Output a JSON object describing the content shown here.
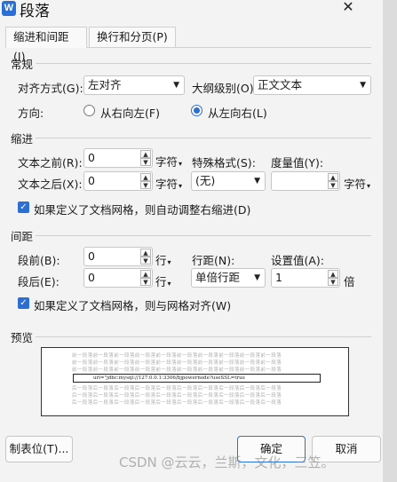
{
  "window": {
    "title": "段落",
    "app_icon_letter": "W",
    "close_glyph": "✕"
  },
  "tabs": [
    {
      "label": "缩进和间距(I)",
      "active": true
    },
    {
      "label": "换行和分页(P)",
      "active": false
    }
  ],
  "general": {
    "section_title": "常规",
    "alignment_label": "对齐方式(G):",
    "alignment_value": "左对齐",
    "outline_label": "大纲级别(O):",
    "outline_value": "正文文本",
    "direction_label": "方向:",
    "rtl_label": "从右向左(F)",
    "ltr_label": "从左向右(L)",
    "selected_direction": "ltr"
  },
  "indent": {
    "section_title": "缩进",
    "before_label": "文本之前(R):",
    "before_value": "0",
    "before_unit": "字符",
    "special_label": "特殊格式(S):",
    "special_value": "(无)",
    "measure_label": "度量值(Y):",
    "measure_value": "",
    "measure_unit": "字符",
    "after_label": "文本之后(X):",
    "after_value": "0",
    "after_unit": "字符",
    "grid_checkbox_label": "如果定义了文档网格，则自动调整右缩进(D)",
    "grid_checked": true
  },
  "spacing": {
    "section_title": "间距",
    "before_label": "段前(B):",
    "before_value": "0",
    "before_unit": "行",
    "line_label": "行距(N):",
    "line_value": "单倍行距",
    "setting_label": "设置值(A):",
    "setting_value": "1",
    "setting_unit": "倍",
    "after_label": "段后(E):",
    "after_value": "0",
    "after_unit": "行",
    "grid_checkbox_label": "如果定义了文档网格，则与网格对齐(W)",
    "grid_checked": true
  },
  "preview": {
    "section_title": "预览",
    "prev_line": "前一段落前一段落前一段落前一段落前一段落前一段落前一段落前一段落前一段落前一段落",
    "current_text": "url=\"jdbc:mysql://127.0.0.1:3306/bjpowernode?useSSL=true",
    "next_line": "后一段落后一段落后一段落后一段落后一段落后一段落后一段落后一段落后一段落后一段落"
  },
  "buttons": {
    "tabs_button": "制表位(T)...",
    "ok": "确定",
    "cancel": "取消"
  },
  "watermark": "CSDN @云云，兰斯，文化，三笠。",
  "colors": {
    "accent": "#2b6fd6",
    "background": "#f3f3f3"
  }
}
